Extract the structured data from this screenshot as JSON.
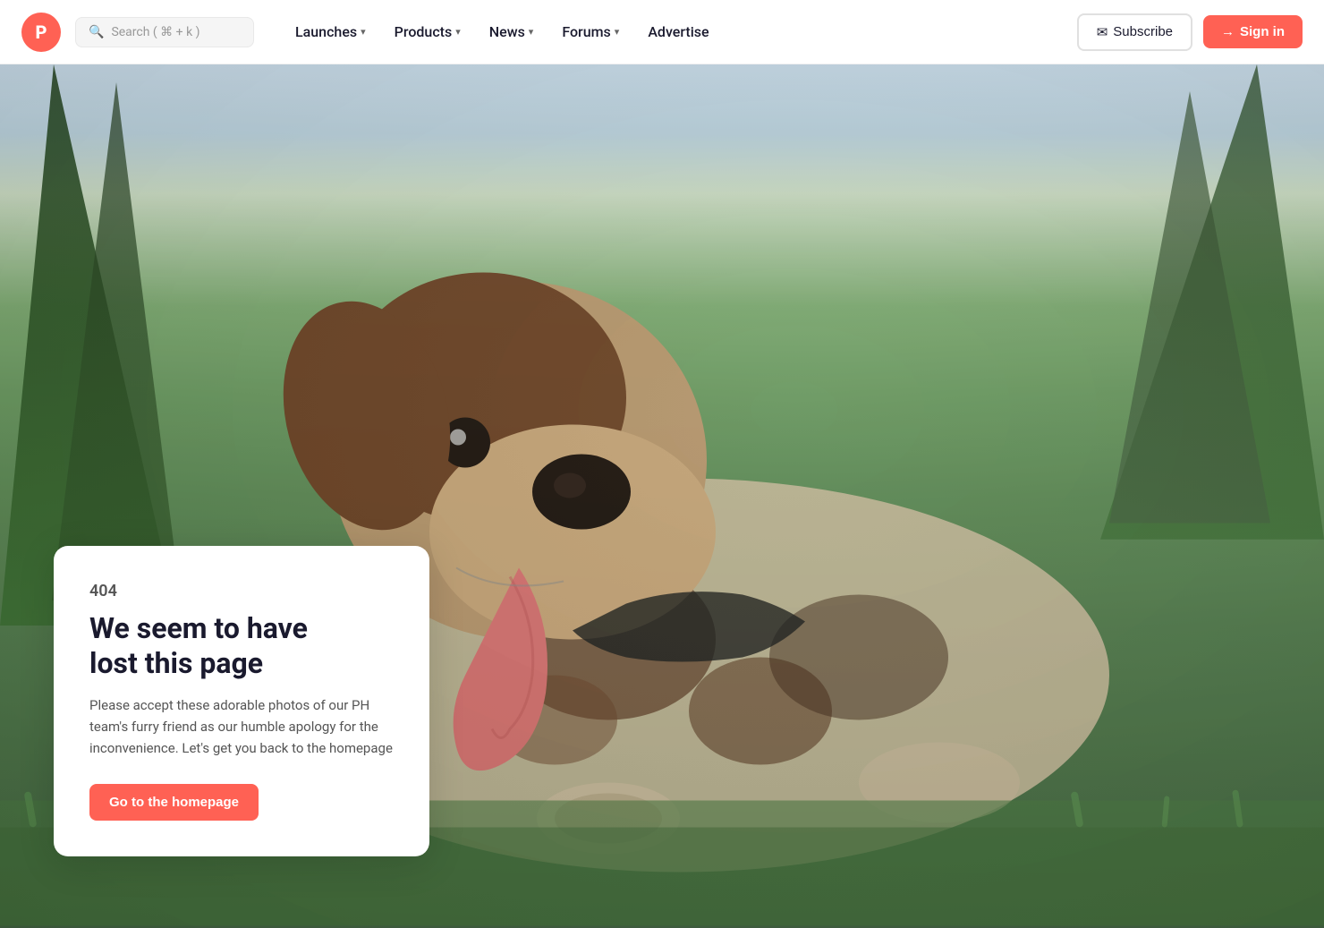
{
  "site": {
    "brand": "P",
    "brand_color": "#ff6154"
  },
  "navbar": {
    "search_placeholder": "Search ( ⌘ + k )",
    "nav_items": [
      {
        "label": "Launches",
        "has_dropdown": true
      },
      {
        "label": "Products",
        "has_dropdown": true
      },
      {
        "label": "News",
        "has_dropdown": true
      },
      {
        "label": "Forums",
        "has_dropdown": true
      },
      {
        "label": "Advertise",
        "has_dropdown": false
      }
    ],
    "subscribe_label": "Subscribe",
    "signin_label": "Sign in"
  },
  "error_page": {
    "error_code": "404",
    "heading_line1": "We seem to have",
    "heading_line2": "lost this page",
    "description": "Please accept these adorable photos of our PH team's furry friend as our humble apology for the inconvenience. Let's get you back to the homepage",
    "cta_label": "Go to the homepage"
  }
}
